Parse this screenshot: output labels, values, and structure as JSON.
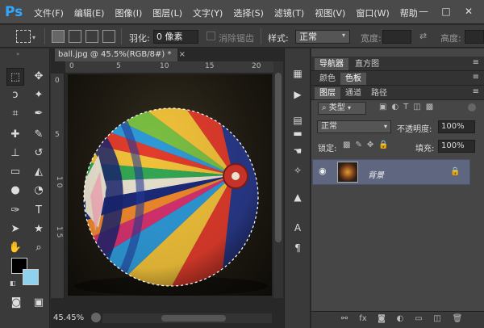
{
  "app": {
    "logo": "Ps"
  },
  "menu": [
    "文件(F)",
    "编辑(E)",
    "图像(I)",
    "图层(L)",
    "文字(Y)",
    "选择(S)",
    "滤镜(T)",
    "视图(V)",
    "窗口(W)",
    "帮助"
  ],
  "window_controls": [
    "—",
    "□",
    "✕"
  ],
  "options": {
    "feather_label": "羽化:",
    "feather_value": "0 像素",
    "antialias_label": "消除锯齿",
    "style_label": "样式:",
    "style_value": "正常",
    "width_label": "宽度:",
    "height_label": "高度:"
  },
  "document": {
    "tab_title": "ball.jpg @ 45.5%(RGB/8#) *",
    "tab_close": "×",
    "ruler_top": [
      "0",
      "5",
      "10",
      "15",
      "20"
    ],
    "ruler_left": [
      "0",
      "5",
      "1 0",
      "1 5"
    ],
    "zoom": "45.45%"
  },
  "colors": {
    "foreground": "#000000",
    "background": "#8fd2ef",
    "layer_selected": "#5e6680",
    "ps_blue": "#31a8ff"
  },
  "panels": {
    "top_tabs": [
      "导航器",
      "直方图"
    ],
    "second_tabs": [
      "颜色",
      "色板"
    ],
    "layer_tabs": [
      "图层",
      "通道",
      "路径"
    ],
    "filter_kind": "类型",
    "blend_mode": "正常",
    "opacity_label": "不透明度:",
    "opacity_value": "100%",
    "lock_label": "锁定:",
    "fill_label": "填充:",
    "fill_value": "100%",
    "layer_name": "背景"
  }
}
